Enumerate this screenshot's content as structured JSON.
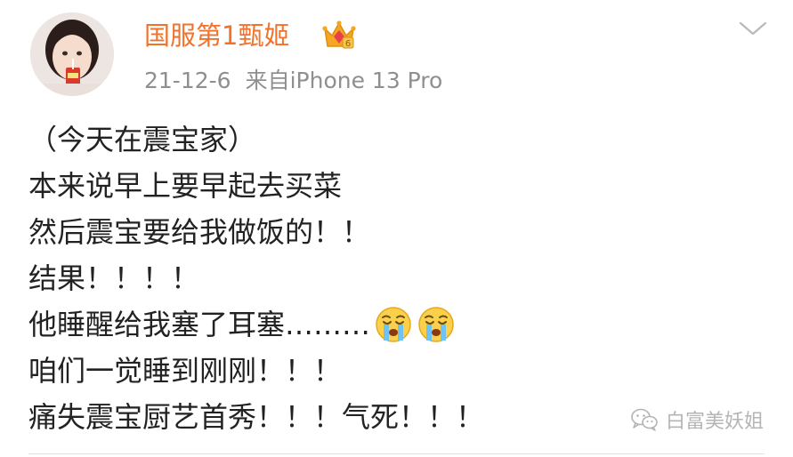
{
  "post": {
    "author": {
      "name": "国服第1甄姬",
      "badge_icon": "crown-vip-icon",
      "avatar_icon": "user-avatar"
    },
    "date": "21-12-6",
    "source": "来自iPhone 13 Pro",
    "menu_icon": "chevron-down-icon",
    "lines": [
      "（今天在震宝家）",
      "本来说早上要早起去买菜",
      "然后震宝要给我做饭的！！",
      "结果！！！！",
      "他睡醒给我塞了耳塞………",
      "咱们一觉睡到刚刚！！！",
      "痛失震宝厨艺首秀！！！气死！！！"
    ],
    "emoji_icon": "crying-face-icon",
    "emoji_count_line_5": 2
  },
  "watermark": {
    "text": "白富美妖姐",
    "icon": "wechat-icon"
  },
  "colors": {
    "username": "#f3722b",
    "meta": "#8f8f8f",
    "body_text": "#222222",
    "watermark": "#b4b4b4"
  }
}
